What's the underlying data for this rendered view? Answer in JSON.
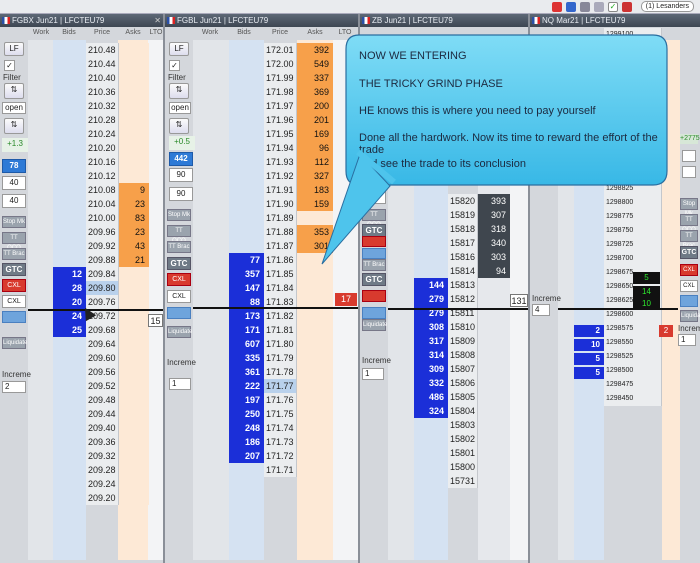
{
  "topbar": {
    "user_label": "(1) Lesanders"
  },
  "panels": [
    {
      "title": "FGBX Jun21 | LFCTEU79"
    },
    {
      "title": "FGBL Jun21 | LFCTEU79"
    },
    {
      "title": "ZB Jun21 | LFCTEU79"
    },
    {
      "title": "NQ Mar21 | LFCTEU79"
    }
  ],
  "columns": {
    "work": "Work",
    "bids": "Bids",
    "price": "Price",
    "asks": "Asks",
    "lto": "LTO"
  },
  "controls": {
    "filter": "Filter",
    "open": "open",
    "lf": "LF",
    "inc": "Increme",
    "p1_pnl": "+1.3",
    "p1_qty": "78",
    "p1_v1": "40",
    "p1_v2": "40",
    "p2_pnl": "+0.5",
    "p2_qty": "442",
    "p2_v1": "90",
    "p2_v2": "90",
    "p3_v1": "50",
    "p4_pnl": "+2775",
    "stop": "Stop Mk",
    "ttoco": "TT OCO",
    "ttbrac": "TT Brac",
    "gtc": "GTC",
    "cxl": "CXL",
    "liquidate": "Liquidate",
    "inc1": "2",
    "inc2": "1",
    "inc3": "1",
    "inc4": "4",
    "inc5": "1"
  },
  "callout": {
    "line1": "NOW WE ENTERING",
    "line2": "THE TRICKY GRIND PHASE",
    "line3": "HE knows this is where you need to pay yourself",
    "line4": "Done all the hardwork. Now its time to reward the effort of the trade",
    "line5": "and see the trade to its conclusion"
  },
  "ladder1": {
    "lto": "15",
    "rows": [
      {
        "p": "210.48",
        "a": "",
        "b": ""
      },
      {
        "p": "210.44",
        "a": "",
        "b": ""
      },
      {
        "p": "210.40",
        "a": "",
        "b": ""
      },
      {
        "p": "210.36",
        "a": "",
        "b": ""
      },
      {
        "p": "210.32",
        "a": "",
        "b": ""
      },
      {
        "p": "210.28",
        "a": "",
        "b": ""
      },
      {
        "p": "210.24",
        "a": "",
        "b": ""
      },
      {
        "p": "210.20",
        "a": "",
        "b": ""
      },
      {
        "p": "210.16",
        "a": "",
        "b": ""
      },
      {
        "p": "210.12",
        "a": "",
        "b": ""
      },
      {
        "p": "210.08",
        "a": "9",
        "b": ""
      },
      {
        "p": "210.04",
        "a": "23",
        "b": ""
      },
      {
        "p": "210.00",
        "a": "83",
        "b": ""
      },
      {
        "p": "209.96",
        "a": "23",
        "b": ""
      },
      {
        "p": "209.92",
        "a": "43",
        "b": ""
      },
      {
        "p": "209.88",
        "a": "21",
        "b": ""
      },
      {
        "p": "209.84",
        "a": "",
        "b": "12"
      },
      {
        "p": "209.80",
        "a": "",
        "b": "28"
      },
      {
        "p": "209.76",
        "a": "",
        "b": "20"
      },
      {
        "p": "209.72",
        "a": "",
        "b": "24"
      },
      {
        "p": "209.68",
        "a": "",
        "b": "25"
      },
      {
        "p": "209.64",
        "a": "",
        "b": ""
      },
      {
        "p": "209.60",
        "a": "",
        "b": ""
      },
      {
        "p": "209.56",
        "a": "",
        "b": ""
      },
      {
        "p": "209.52",
        "a": "",
        "b": ""
      },
      {
        "p": "209.48",
        "a": "",
        "b": ""
      },
      {
        "p": "209.44",
        "a": "",
        "b": ""
      },
      {
        "p": "209.40",
        "a": "",
        "b": ""
      },
      {
        "p": "209.36",
        "a": "",
        "b": ""
      },
      {
        "p": "209.32",
        "a": "",
        "b": ""
      },
      {
        "p": "209.28",
        "a": "",
        "b": ""
      },
      {
        "p": "209.24",
        "a": "",
        "b": ""
      },
      {
        "p": "209.20",
        "a": "",
        "b": ""
      }
    ]
  },
  "ladder2": {
    "lto": "17",
    "rows": [
      {
        "p": "172.01",
        "a": "392",
        "b": ""
      },
      {
        "p": "172.00",
        "a": "549",
        "b": ""
      },
      {
        "p": "171.99",
        "a": "337",
        "b": ""
      },
      {
        "p": "171.98",
        "a": "369",
        "b": ""
      },
      {
        "p": "171.97",
        "a": "200",
        "b": ""
      },
      {
        "p": "171.96",
        "a": "201",
        "b": ""
      },
      {
        "p": "171.95",
        "a": "169",
        "b": ""
      },
      {
        "p": "171.94",
        "a": "96",
        "b": ""
      },
      {
        "p": "171.93",
        "a": "112",
        "b": ""
      },
      {
        "p": "171.92",
        "a": "327",
        "b": ""
      },
      {
        "p": "171.91",
        "a": "183",
        "b": ""
      },
      {
        "p": "171.90",
        "a": "159",
        "b": ""
      },
      {
        "p": "171.89",
        "a": "",
        "b": ""
      },
      {
        "p": "171.88",
        "a": "353",
        "b": ""
      },
      {
        "p": "171.87",
        "a": "301",
        "b": ""
      },
      {
        "p": "171.86",
        "a": "",
        "b": "77"
      },
      {
        "p": "171.85",
        "a": "",
        "b": "357"
      },
      {
        "p": "171.84",
        "a": "",
        "b": "147"
      },
      {
        "p": "171.83",
        "a": "",
        "b": "88"
      },
      {
        "p": "171.82",
        "a": "",
        "b": "173"
      },
      {
        "p": "171.81",
        "a": "",
        "b": "171"
      },
      {
        "p": "171.80",
        "a": "",
        "b": "607"
      },
      {
        "p": "171.79",
        "a": "",
        "b": "335"
      },
      {
        "p": "171.78",
        "a": "",
        "b": "361"
      },
      {
        "p": "171.77",
        "a": "",
        "b": "222"
      },
      {
        "p": "171.76",
        "a": "",
        "b": "197"
      },
      {
        "p": "171.75",
        "a": "",
        "b": "250"
      },
      {
        "p": "171.74",
        "a": "",
        "b": "248"
      },
      {
        "p": "171.73",
        "a": "",
        "b": "186"
      },
      {
        "p": "171.72",
        "a": "",
        "b": "207"
      },
      {
        "p": "171.71",
        "a": "",
        "b": ""
      }
    ]
  },
  "ladder3": {
    "lto": "131",
    "rows": [
      {
        "p": "15820",
        "a": "393",
        "b": ""
      },
      {
        "p": "15819",
        "a": "307",
        "b": ""
      },
      {
        "p": "15818",
        "a": "318",
        "b": ""
      },
      {
        "p": "15817",
        "a": "340",
        "b": ""
      },
      {
        "p": "15816",
        "a": "303",
        "b": ""
      },
      {
        "p": "15814",
        "a": "94",
        "b": ""
      },
      {
        "p": "15813",
        "a": "",
        "b": "144"
      },
      {
        "p": "15812",
        "a": "",
        "b": "279"
      },
      {
        "p": "15811",
        "a": "",
        "b": "279"
      },
      {
        "p": "15810",
        "a": "",
        "b": "308"
      },
      {
        "p": "15809",
        "a": "",
        "b": "317"
      },
      {
        "p": "15808",
        "a": "",
        "b": "314"
      },
      {
        "p": "15807",
        "a": "",
        "b": "309"
      },
      {
        "p": "15806",
        "a": "",
        "b": "332"
      },
      {
        "p": "15805",
        "a": "",
        "b": "486"
      },
      {
        "p": "15804",
        "a": "",
        "b": "324"
      },
      {
        "p": "15803",
        "a": "",
        "b": ""
      },
      {
        "p": "15802",
        "a": "",
        "b": ""
      },
      {
        "p": "15801",
        "a": "",
        "b": ""
      },
      {
        "p": "15800",
        "a": "",
        "b": ""
      },
      {
        "p": "15731",
        "a": "",
        "b": ""
      }
    ]
  },
  "ladder4": {
    "rows": [
      {
        "p": "1299100",
        "b": ""
      },
      {
        "p": "1299075",
        "b": ""
      },
      {
        "p": "1299050",
        "b": ""
      },
      {
        "p": "1299025",
        "b": ""
      },
      {
        "p": "1299000",
        "b": ""
      },
      {
        "p": "1298975",
        "b": ""
      },
      {
        "p": "1298950",
        "b": ""
      },
      {
        "p": "1298925",
        "b": ""
      },
      {
        "p": "1298900",
        "b": ""
      },
      {
        "p": "1298875",
        "b": ""
      },
      {
        "p": "1298850",
        "b": ""
      },
      {
        "p": "1298825",
        "b": ""
      },
      {
        "p": "1298800",
        "b": ""
      },
      {
        "p": "1298775",
        "b": ""
      },
      {
        "p": "1298750",
        "b": ""
      },
      {
        "p": "1298725",
        "b": ""
      },
      {
        "p": "1298700",
        "b": ""
      },
      {
        "p": "1298675",
        "b": ""
      },
      {
        "p": "1298650",
        "b": ""
      },
      {
        "p": "1298625",
        "b": ""
      },
      {
        "p": "1298600",
        "b": ""
      },
      {
        "p": "1298575",
        "b": ""
      },
      {
        "p": "1298550",
        "b": ""
      },
      {
        "p": "1298525",
        "b": ""
      },
      {
        "p": "1298500",
        "b": ""
      },
      {
        "p": "1298475",
        "b": ""
      },
      {
        "p": "1298450",
        "b": ""
      },
      {
        "p": "1298425",
        "b": ""
      },
      {
        "p": "1298400",
        "b": ""
      },
      {
        "p": "1298375",
        "b": ""
      },
      {
        "p": "1298350",
        "b": ""
      },
      {
        "p": "1298325",
        "b": ""
      },
      {
        "p": "1298300",
        "b": ""
      },
      {
        "p": "1298275",
        "b": ""
      },
      {
        "p": "1298250",
        "b": ""
      },
      {
        "p": "1298225",
        "b": ""
      },
      {
        "p": "1298200",
        "b": ""
      },
      {
        "p": "1298175",
        "b": ""
      },
      {
        "p": "1298150",
        "b": ""
      },
      {
        "p": "1298125",
        "b": ""
      },
      {
        "p": "1298100",
        "b": ""
      },
      {
        "p": "1298075",
        "b": ""
      },
      {
        "p": "1298050",
        "b": ""
      }
    ],
    "visible_top": [
      {
        "p": "1299100"
      },
      {
        "p": "1299075"
      },
      {
        "p": "1299050"
      },
      {
        "p": "1299025"
      },
      {
        "p": "1299000"
      },
      {
        "p": "1298975"
      },
      {
        "p": "1298950"
      },
      {
        "p": "1298925"
      },
      {
        "p": "1298900"
      },
      {
        "p": "1298875"
      },
      {
        "p": "1298850"
      },
      {
        "p": "1298825"
      },
      {
        "p": "1298800"
      },
      {
        "p": "1298775"
      },
      {
        "p": "1298750"
      },
      {
        "p": "1298725"
      },
      {
        "p": "1298700"
      },
      {
        "p": "1298675"
      },
      {
        "p": "1298650"
      },
      {
        "p": "1298625"
      }
    ],
    "trades": [
      "5",
      "14",
      "10"
    ],
    "bids": [
      "2",
      "10",
      "5",
      "5"
    ],
    "red": "2"
  }
}
